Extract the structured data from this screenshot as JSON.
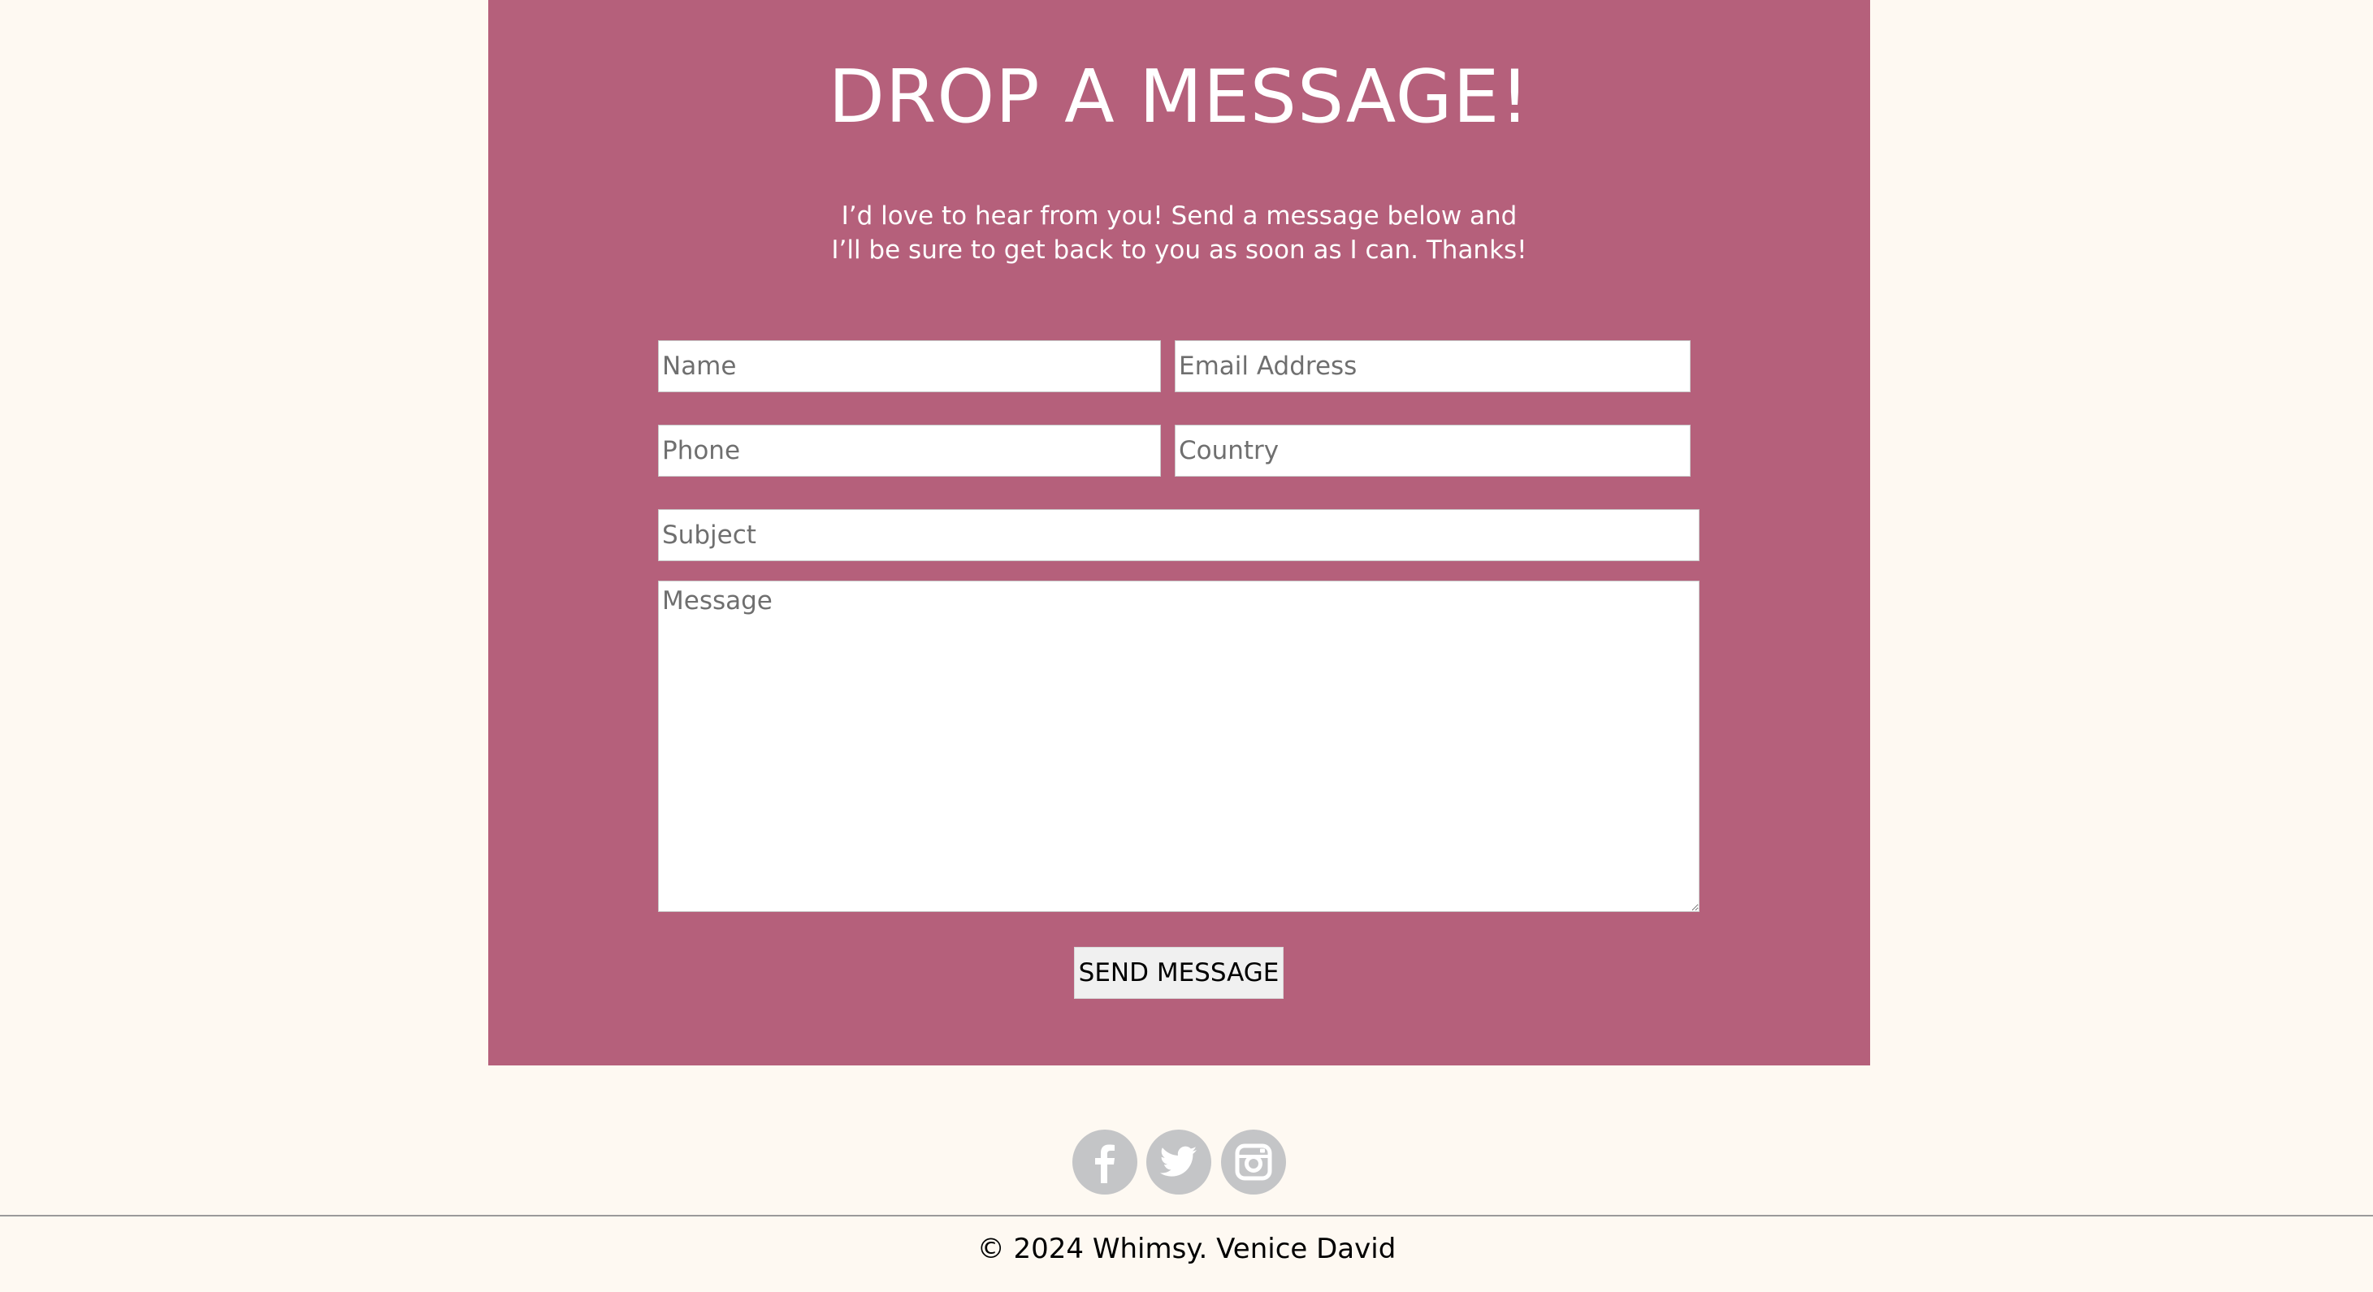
{
  "contact": {
    "title": "DROP A MESSAGE!",
    "intro_line1": "I’d love to hear from you! Send a message below and",
    "intro_line2": "I’ll be sure to get back to you as soon as I can. Thanks!",
    "fields": {
      "name_placeholder": "Name",
      "email_placeholder": "Email Address",
      "phone_placeholder": "Phone",
      "country_placeholder": "Country",
      "subject_placeholder": "Subject",
      "message_placeholder": "Message"
    },
    "send_label": "SEND MESSAGE"
  },
  "social": {
    "icons": [
      "facebook-icon",
      "twitter-icon",
      "instagram-icon"
    ],
    "icon_color": "#c4c5c7"
  },
  "footer": {
    "copyright": "© 2024 Whimsy. Venice David"
  },
  "colors": {
    "page_background": "#fef9f2",
    "panel_background": "#b5607b",
    "heading_text": "#ffffff"
  }
}
